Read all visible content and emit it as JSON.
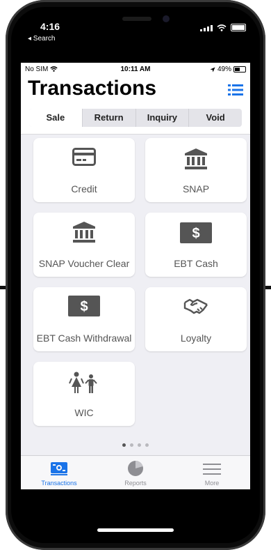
{
  "outer_status": {
    "time": "4:16",
    "back_label": "◂ Search"
  },
  "inner_status": {
    "carrier": "No SIM",
    "time": "10:11 AM",
    "battery": "49%"
  },
  "header": {
    "title": "Transactions"
  },
  "segments": [
    "Sale",
    "Return",
    "Inquiry",
    "Void"
  ],
  "tiles": [
    {
      "label": "Credit",
      "icon": "credit-card-icon"
    },
    {
      "label": "SNAP",
      "icon": "bank-icon"
    },
    {
      "label": "SNAP Voucher Clear",
      "icon": "bank-icon"
    },
    {
      "label": "EBT Cash",
      "icon": "dollar-icon"
    },
    {
      "label": "EBT Cash Withdrawal",
      "icon": "dollar-icon"
    },
    {
      "label": "Loyalty",
      "icon": "handshake-icon"
    },
    {
      "label": "WIC",
      "icon": "family-icon"
    }
  ],
  "page_dots": {
    "count": 4,
    "active": 1
  },
  "tabs": [
    {
      "label": "Transactions",
      "icon": "transactions-icon",
      "active": true
    },
    {
      "label": "Reports",
      "icon": "pie-chart-icon",
      "active": false
    },
    {
      "label": "More",
      "icon": "menu-icon",
      "active": false
    }
  ],
  "colors": {
    "accent": "#1a73e8",
    "background": "#efeff4"
  }
}
